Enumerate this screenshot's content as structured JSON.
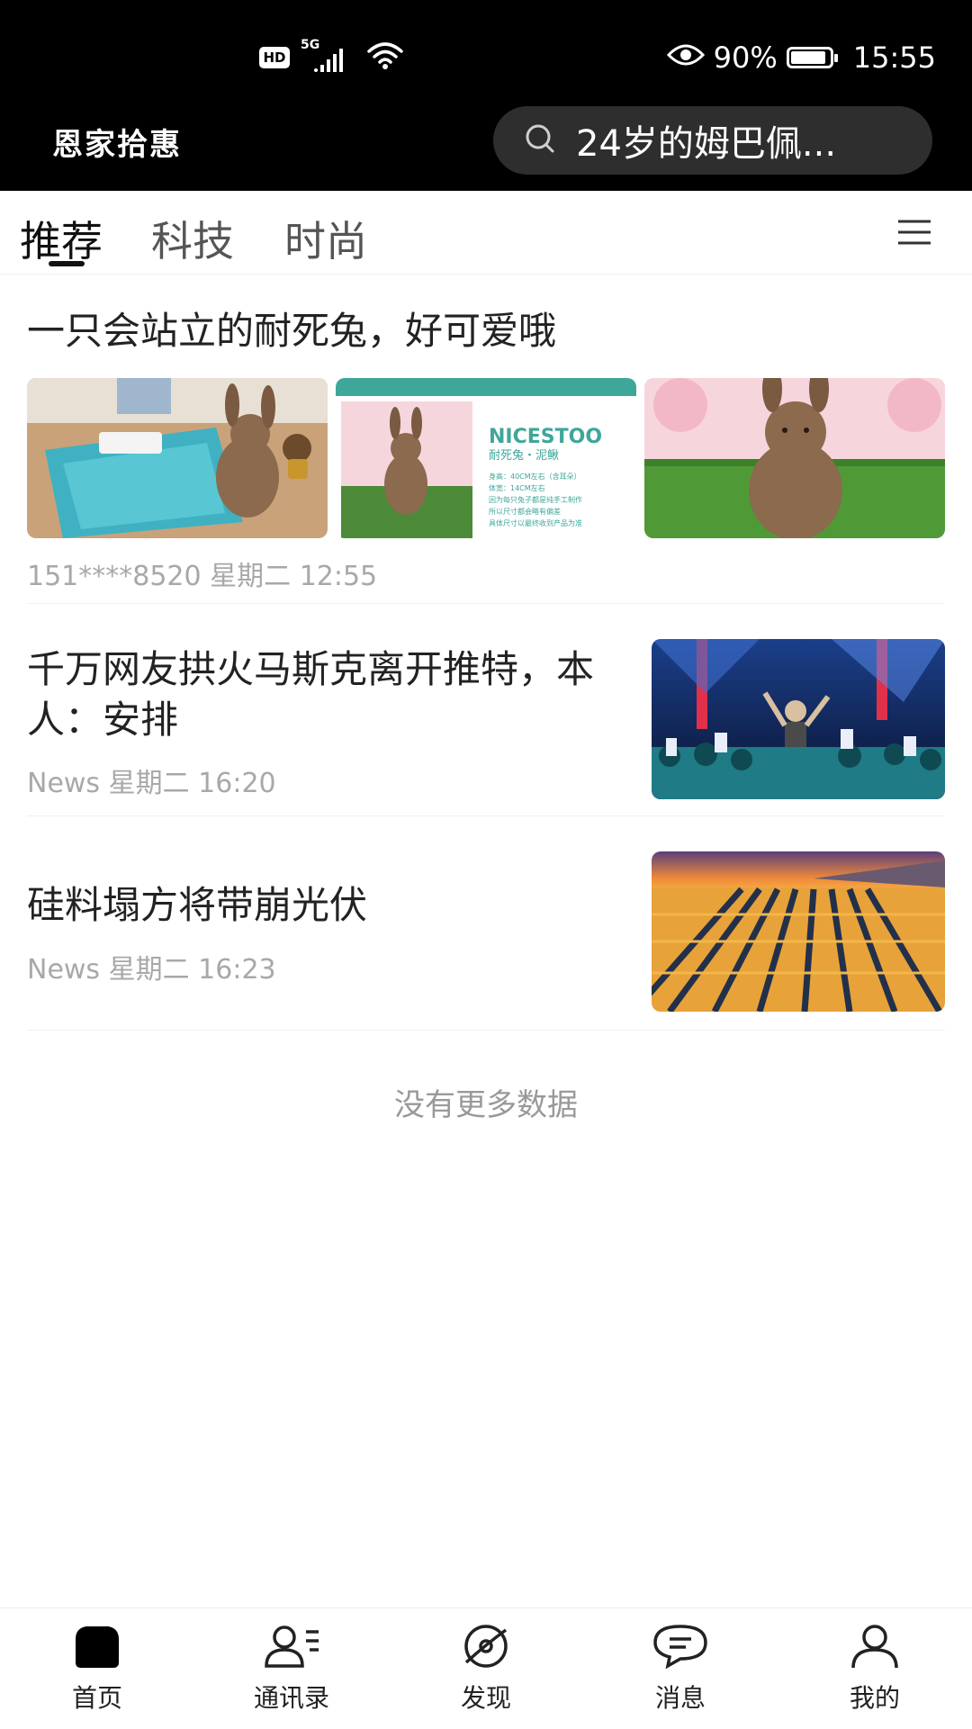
{
  "status_bar": {
    "hd": "HD",
    "network": "5G",
    "battery_text": "90%",
    "battery_level": 0.9,
    "time": "15:55"
  },
  "header": {
    "brand": "恩家拾惠",
    "search_text": "24岁的姆巴佩..."
  },
  "tabs": [
    {
      "label": "推荐",
      "active": true
    },
    {
      "label": "科技",
      "active": false
    },
    {
      "label": "时尚",
      "active": false
    }
  ],
  "articles": [
    {
      "title": "一只会站立的耐死兔，好可爱哦",
      "source": "151****8520",
      "time": "星期二 12:55",
      "image_text": {
        "brand": "NICESTOO",
        "subtitle": "耐死兔・泥鳅",
        "lines": [
          "身高：40CM左右（含耳朵）",
          "体宽：14CM左右",
          "因为每只兔子都是纯手工制作",
          "所以尺寸都会略有偏差",
          "具体尺寸以最终收到产品为准"
        ]
      }
    },
    {
      "title": "千万网友拱火马斯克离开推特，本人：安排",
      "source": "News",
      "time": "星期二 16:20"
    },
    {
      "title": "硅料塌方将带崩光伏",
      "source": "News",
      "time": "星期二 16:23"
    }
  ],
  "end_note": "没有更多数据",
  "bottom_nav": [
    {
      "label": "首页",
      "icon": "home-icon",
      "active": true
    },
    {
      "label": "通讯录",
      "icon": "contacts-icon",
      "active": false
    },
    {
      "label": "发现",
      "icon": "discover-icon",
      "active": false
    },
    {
      "label": "消息",
      "icon": "message-icon",
      "active": false
    },
    {
      "label": "我的",
      "icon": "profile-icon",
      "active": false
    }
  ],
  "colors": {
    "header_bg": "#000000",
    "search_bg": "#2e2e2e",
    "meta_text": "#a8a8a8",
    "teal_accent": "#3fa69a"
  }
}
